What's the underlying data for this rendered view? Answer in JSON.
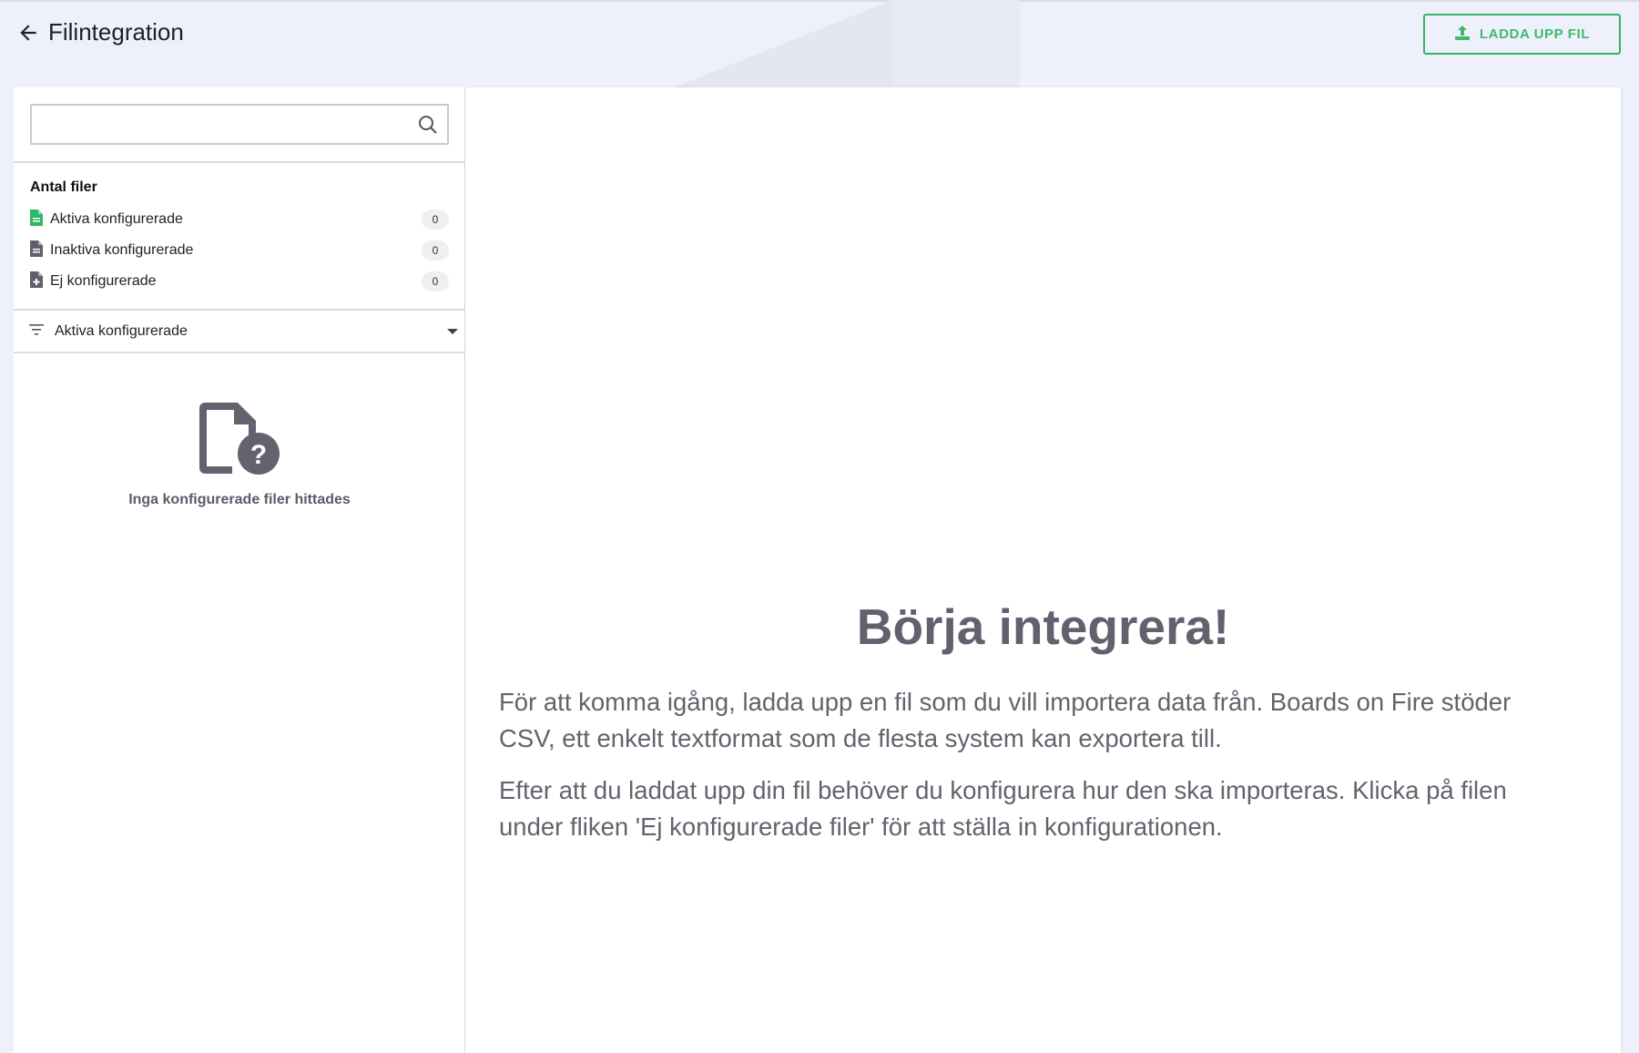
{
  "header": {
    "title": "Filintegration",
    "upload_label": "LADDA UPP FIL"
  },
  "sidebar": {
    "search": {
      "value": "",
      "placeholder": ""
    },
    "section_title": "Antal filer",
    "items": [
      {
        "label": "Aktiva konfigurerade",
        "count": "0",
        "icon": "file-green-icon"
      },
      {
        "label": "Inaktiva konfigurerade",
        "count": "0",
        "icon": "file-gray-icon"
      },
      {
        "label": "Ej konfigurerade",
        "count": "0",
        "icon": "file-plus-icon"
      }
    ],
    "filter": {
      "selected": "Aktiva konfigurerade"
    },
    "empty_text": "Inga konfigurerade filer hittades"
  },
  "main": {
    "heading": "Börja integrera!",
    "paragraphs": [
      "För att komma igång, ladda upp en fil som du vill importera data från. Boards on Fire stöder CSV, ett enkelt textformat som de flesta system kan exportera till.",
      "Efter att du laddat upp din fil behöver du konfigurera hur den ska importeras. Klicka på filen under fliken 'Ej konfigurerade filer' för att ställa in konfigurationen."
    ]
  },
  "colors": {
    "accent": "#2fb865",
    "heading": "#61626f"
  }
}
